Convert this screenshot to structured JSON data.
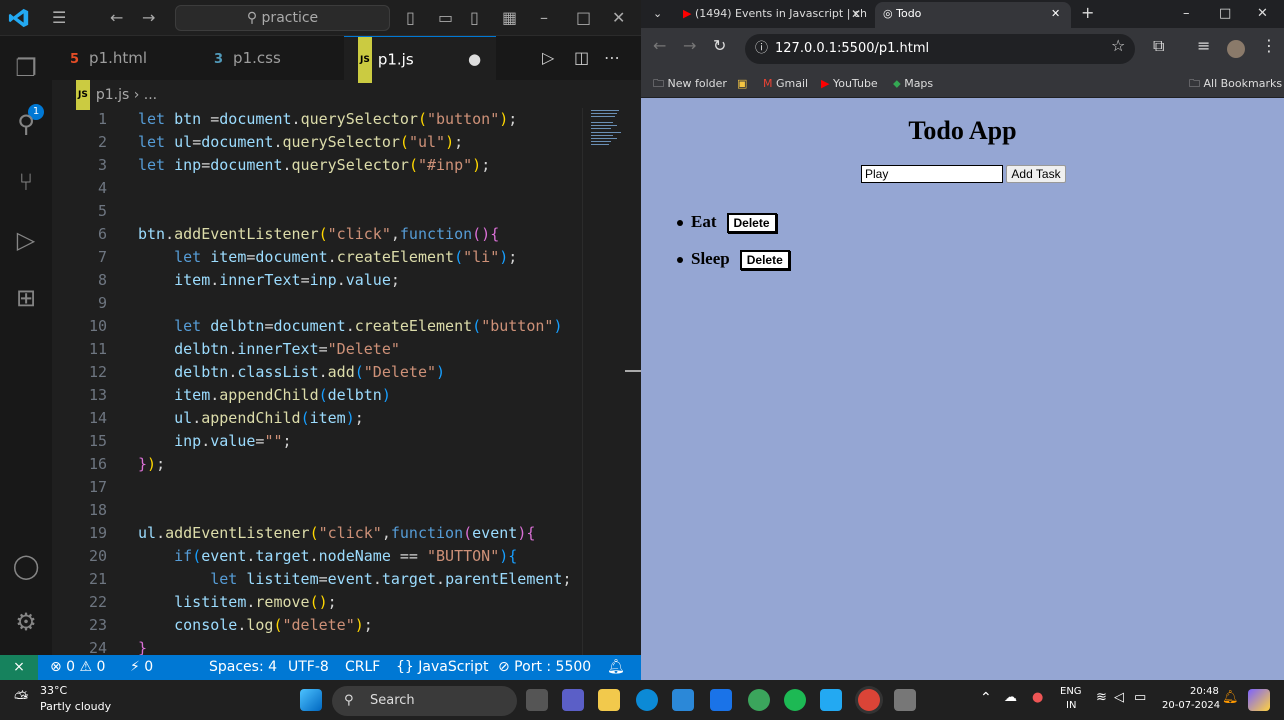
{
  "vscode": {
    "search_text": "practice",
    "activity_badge": "1",
    "tabs": [
      {
        "label": "p1.html",
        "icon": "5"
      },
      {
        "label": "p1.css",
        "icon": "3"
      },
      {
        "label": "p1.js",
        "icon": "JS"
      }
    ],
    "breadcrumb": {
      "file": "p1.js",
      "rest": "..."
    },
    "lines": [
      {
        "n": "1",
        "c": [
          [
            "kw",
            "let "
          ],
          [
            "var",
            "btn"
          ],
          [
            "op",
            " ="
          ],
          [
            "var",
            "document"
          ],
          [
            "op",
            "."
          ],
          [
            "fn",
            "querySelector"
          ],
          [
            "br1",
            "("
          ],
          [
            "str",
            "\"button\""
          ],
          [
            "br1",
            ")"
          ],
          [
            "op",
            ";"
          ]
        ]
      },
      {
        "n": "2",
        "c": [
          [
            "kw",
            "let "
          ],
          [
            "var",
            "ul"
          ],
          [
            "op",
            "="
          ],
          [
            "var",
            "document"
          ],
          [
            "op",
            "."
          ],
          [
            "fn",
            "querySelector"
          ],
          [
            "br1",
            "("
          ],
          [
            "str",
            "\"ul\""
          ],
          [
            "br1",
            ")"
          ],
          [
            "op",
            ";"
          ]
        ]
      },
      {
        "n": "3",
        "c": [
          [
            "kw",
            "let "
          ],
          [
            "var",
            "inp"
          ],
          [
            "op",
            "="
          ],
          [
            "var",
            "document"
          ],
          [
            "op",
            "."
          ],
          [
            "fn",
            "querySelector"
          ],
          [
            "br1",
            "("
          ],
          [
            "str",
            "\"#inp\""
          ],
          [
            "br1",
            ")"
          ],
          [
            "op",
            ";"
          ]
        ]
      },
      {
        "n": "4",
        "c": []
      },
      {
        "n": "5",
        "c": []
      },
      {
        "n": "6",
        "c": [
          [
            "var",
            "btn"
          ],
          [
            "op",
            "."
          ],
          [
            "fn",
            "addEventListener"
          ],
          [
            "br1",
            "("
          ],
          [
            "str",
            "\"click\""
          ],
          [
            "op",
            ","
          ],
          [
            "kw",
            "function"
          ],
          [
            "br2",
            "()"
          ],
          [
            "br2",
            "{"
          ]
        ]
      },
      {
        "n": "7",
        "c": [
          [
            "op",
            "    "
          ],
          [
            "kw",
            "let "
          ],
          [
            "var",
            "item"
          ],
          [
            "op",
            "="
          ],
          [
            "var",
            "document"
          ],
          [
            "op",
            "."
          ],
          [
            "fn",
            "createElement"
          ],
          [
            "br3",
            "("
          ],
          [
            "str",
            "\"li\""
          ],
          [
            "br3",
            ")"
          ],
          [
            "op",
            ";"
          ]
        ]
      },
      {
        "n": "8",
        "c": [
          [
            "op",
            "    "
          ],
          [
            "var",
            "item"
          ],
          [
            "op",
            "."
          ],
          [
            "var",
            "innerText"
          ],
          [
            "op",
            "="
          ],
          [
            "var",
            "inp"
          ],
          [
            "op",
            "."
          ],
          [
            "var",
            "value"
          ],
          [
            "op",
            ";"
          ]
        ]
      },
      {
        "n": "9",
        "c": []
      },
      {
        "n": "10",
        "c": [
          [
            "op",
            "    "
          ],
          [
            "kw",
            "let "
          ],
          [
            "var",
            "delbtn"
          ],
          [
            "op",
            "="
          ],
          [
            "var",
            "document"
          ],
          [
            "op",
            "."
          ],
          [
            "fn",
            "createElement"
          ],
          [
            "br3",
            "("
          ],
          [
            "str",
            "\"button\""
          ],
          [
            "br3",
            ")"
          ]
        ]
      },
      {
        "n": "11",
        "c": [
          [
            "op",
            "    "
          ],
          [
            "var",
            "delbtn"
          ],
          [
            "op",
            "."
          ],
          [
            "var",
            "innerText"
          ],
          [
            "op",
            "="
          ],
          [
            "str",
            "\"Delete\""
          ]
        ]
      },
      {
        "n": "12",
        "c": [
          [
            "op",
            "    "
          ],
          [
            "var",
            "delbtn"
          ],
          [
            "op",
            "."
          ],
          [
            "var",
            "classList"
          ],
          [
            "op",
            "."
          ],
          [
            "fn",
            "add"
          ],
          [
            "br3",
            "("
          ],
          [
            "str",
            "\"Delete\""
          ],
          [
            "br3",
            ")"
          ]
        ]
      },
      {
        "n": "13",
        "c": [
          [
            "op",
            "    "
          ],
          [
            "var",
            "item"
          ],
          [
            "op",
            "."
          ],
          [
            "fn",
            "appendChild"
          ],
          [
            "br3",
            "("
          ],
          [
            "var",
            "delbtn"
          ],
          [
            "br3",
            ")"
          ]
        ]
      },
      {
        "n": "14",
        "c": [
          [
            "op",
            "    "
          ],
          [
            "var",
            "ul"
          ],
          [
            "op",
            "."
          ],
          [
            "fn",
            "appendChild"
          ],
          [
            "br3",
            "("
          ],
          [
            "var",
            "item"
          ],
          [
            "br3",
            ")"
          ],
          [
            "op",
            ";"
          ]
        ]
      },
      {
        "n": "15",
        "c": [
          [
            "op",
            "    "
          ],
          [
            "var",
            "inp"
          ],
          [
            "op",
            "."
          ],
          [
            "var",
            "value"
          ],
          [
            "op",
            "="
          ],
          [
            "str",
            "\"\""
          ],
          [
            "op",
            ";"
          ]
        ]
      },
      {
        "n": "16",
        "c": [
          [
            "br2",
            "}"
          ],
          [
            "br1",
            ")"
          ],
          [
            "op",
            ";"
          ]
        ]
      },
      {
        "n": "17",
        "c": []
      },
      {
        "n": "18",
        "c": []
      },
      {
        "n": "19",
        "c": [
          [
            "var",
            "ul"
          ],
          [
            "op",
            "."
          ],
          [
            "fn",
            "addEventListener"
          ],
          [
            "br1",
            "("
          ],
          [
            "str",
            "\"click\""
          ],
          [
            "op",
            ","
          ],
          [
            "kw",
            "function"
          ],
          [
            "br2",
            "("
          ],
          [
            "var",
            "event"
          ],
          [
            "br2",
            ")"
          ],
          [
            "br2",
            "{"
          ]
        ]
      },
      {
        "n": "20",
        "c": [
          [
            "op",
            "    "
          ],
          [
            "kw",
            "if"
          ],
          [
            "br3",
            "("
          ],
          [
            "var",
            "event"
          ],
          [
            "op",
            "."
          ],
          [
            "var",
            "target"
          ],
          [
            "op",
            "."
          ],
          [
            "var",
            "nodeName"
          ],
          [
            "op",
            " == "
          ],
          [
            "str",
            "\"BUTTON\""
          ],
          [
            "br3",
            ")"
          ],
          [
            "br3",
            "{"
          ]
        ]
      },
      {
        "n": "21",
        "c": [
          [
            "op",
            "        "
          ],
          [
            "kw",
            "let "
          ],
          [
            "var",
            "listitem"
          ],
          [
            "op",
            "="
          ],
          [
            "var",
            "event"
          ],
          [
            "op",
            "."
          ],
          [
            "var",
            "target"
          ],
          [
            "op",
            "."
          ],
          [
            "var",
            "parentElement"
          ],
          [
            "op",
            ";"
          ]
        ]
      },
      {
        "n": "22",
        "c": [
          [
            "op",
            "    "
          ],
          [
            "var",
            "listitem"
          ],
          [
            "op",
            "."
          ],
          [
            "fn",
            "remove"
          ],
          [
            "br1",
            "()"
          ],
          [
            "op",
            ";"
          ]
        ]
      },
      {
        "n": "23",
        "c": [
          [
            "op",
            "    "
          ],
          [
            "var",
            "console"
          ],
          [
            "op",
            "."
          ],
          [
            "fn",
            "log"
          ],
          [
            "br1",
            "("
          ],
          [
            "str",
            "\"delete\""
          ],
          [
            "br1",
            ")"
          ],
          [
            "op",
            ";"
          ]
        ]
      },
      {
        "n": "24",
        "c": [
          [
            "br2",
            "}"
          ]
        ]
      }
    ],
    "status": {
      "problems": "⊗ 0 ⚠ 0",
      "ports": "⚡ 0",
      "spaces": "Spaces: 4",
      "encoding": "UTF-8",
      "eol": "CRLF",
      "language": "{} JavaScript",
      "port": "⊘ Port : 5500"
    }
  },
  "chrome": {
    "tabs": [
      {
        "title": "(1494) Events in Javascript | cha"
      },
      {
        "title": "Todo"
      }
    ],
    "url": "127.0.0.1:5500/p1.html",
    "bookmarks": [
      "New folder",
      "Gmail",
      "YouTube",
      "Maps"
    ],
    "all_bookmarks": "All Bookmarks",
    "page": {
      "title": "Todo App",
      "input_value": "Play",
      "add_button": "Add Task",
      "items": [
        {
          "text": "Eat",
          "button": "Delete"
        },
        {
          "text": "Sleep",
          "button": "Delete"
        }
      ]
    }
  },
  "taskbar": {
    "weather_temp": "33°C",
    "weather_desc": "Partly cloudy",
    "search": "Search",
    "lang1": "ENG",
    "lang2": "IN",
    "time": "20:48",
    "date": "20-07-2024"
  }
}
